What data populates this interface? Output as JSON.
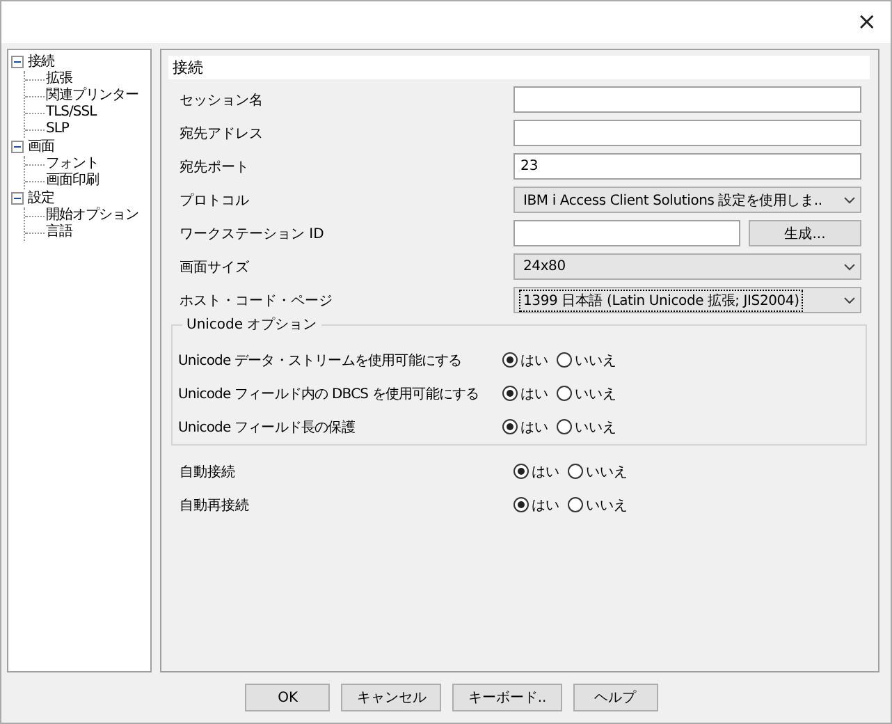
{
  "window": {
    "close": "×"
  },
  "tree": [
    {
      "label": "接続",
      "expanded": true,
      "children": [
        {
          "label": "拡張"
        },
        {
          "label": "関連プリンター"
        },
        {
          "label": "TLS/SSL"
        },
        {
          "label": "SLP"
        }
      ]
    },
    {
      "label": "画面",
      "expanded": true,
      "children": [
        {
          "label": "フォント"
        },
        {
          "label": "画面印刷"
        }
      ]
    },
    {
      "label": "設定",
      "expanded": true,
      "children": [
        {
          "label": "開始オプション"
        },
        {
          "label": "言語"
        }
      ]
    }
  ],
  "section_title": "接続",
  "fields": [
    {
      "kind": "text",
      "label": "セッション名"
    },
    {
      "kind": "text",
      "label": "宛先アドレス"
    },
    {
      "kind": "text",
      "label": "宛先ポート",
      "value": "23"
    },
    {
      "kind": "dropdown",
      "label": "プロトコル",
      "value": "IBM i Access Client Solutions 設定を使用しま..",
      "focused": false
    },
    {
      "kind": "text_button",
      "label": "ワークステーション ID",
      "button": "生成..."
    },
    {
      "kind": "dropdown",
      "label": "画面サイズ",
      "value": "24x80",
      "focused": false
    },
    {
      "kind": "dropdown",
      "label": "ホスト・コード・ページ",
      "value": "1399 日本語 (Latin Unicode 拡張; JIS2004)",
      "focused": true
    }
  ],
  "unicode_group": {
    "title": "Unicode オプション",
    "rows": [
      {
        "label": "Unicode データ・ストリームを使用可能にする",
        "options": [
          {
            "label": "はい",
            "selected": true
          },
          {
            "label": "いいえ",
            "selected": false
          }
        ]
      },
      {
        "label": "Unicode フィールド内の DBCS を使用可能にする",
        "options": [
          {
            "label": "はい",
            "selected": true
          },
          {
            "label": "いいえ",
            "selected": false
          }
        ]
      },
      {
        "label": "Unicode フィールド長の保護",
        "options": [
          {
            "label": "はい",
            "selected": true
          },
          {
            "label": "いいえ",
            "selected": false
          }
        ]
      }
    ]
  },
  "connect_rows": [
    {
      "label": "自動接続",
      "options": [
        {
          "label": "はい",
          "selected": true
        },
        {
          "label": "いいえ",
          "selected": false
        }
      ]
    },
    {
      "label": "自動再接続",
      "options": [
        {
          "label": "はい",
          "selected": true
        },
        {
          "label": "いいえ",
          "selected": false
        }
      ]
    }
  ],
  "buttons": [
    "OK",
    "キャンセル",
    "キーボード..",
    "ヘルプ"
  ]
}
